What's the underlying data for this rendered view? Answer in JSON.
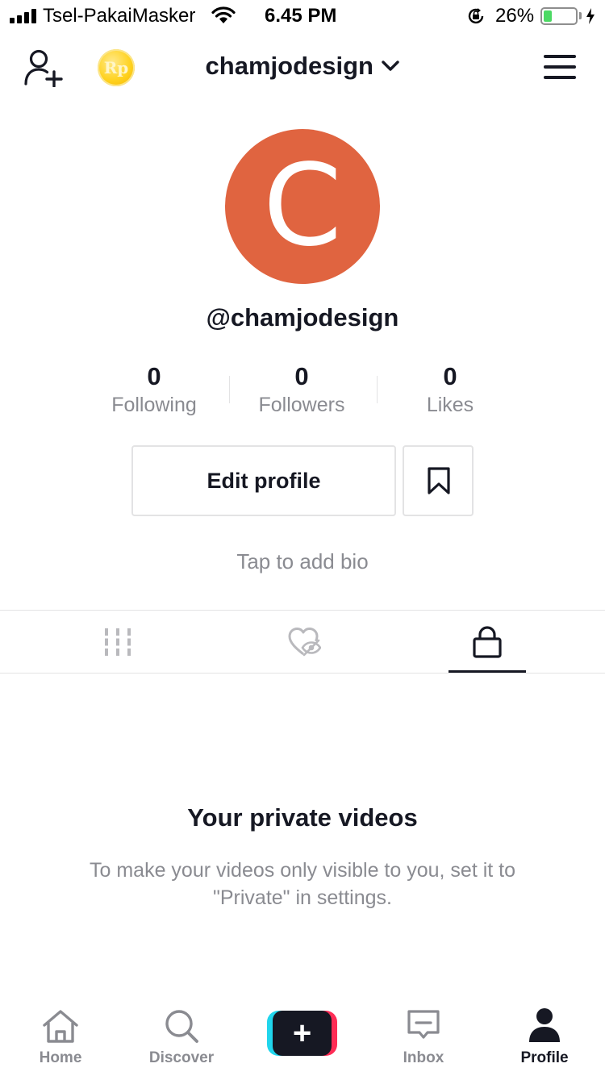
{
  "status_bar": {
    "carrier": "Tsel-PakaiMasker",
    "time": "6.45 PM",
    "battery_percent": "26%",
    "battery_level": 0.26,
    "signal_icon": "cellular-signal-icon",
    "wifi_icon": "wifi-icon",
    "rotation_icon": "rotation-lock-icon",
    "charging_icon": "charging-bolt-icon"
  },
  "header": {
    "username": "chamjodesign",
    "coin_label": "Rp",
    "add_user_icon": "add-user-icon",
    "dropdown_icon": "chevron-down-icon",
    "menu_icon": "hamburger-menu-icon"
  },
  "profile": {
    "avatar_letter": "C",
    "avatar_color": "#e06440",
    "handle": "@chamjodesign",
    "stats": [
      {
        "value": "0",
        "label": "Following"
      },
      {
        "value": "0",
        "label": "Followers"
      },
      {
        "value": "0",
        "label": "Likes"
      }
    ],
    "edit_button": "Edit profile",
    "bookmark_icon": "bookmark-icon",
    "bio_placeholder": "Tap to add bio"
  },
  "tabs": [
    {
      "icon": "grid-icon",
      "active": false
    },
    {
      "icon": "liked-hidden-icon",
      "active": false
    },
    {
      "icon": "lock-icon",
      "active": true
    }
  ],
  "empty_state": {
    "title": "Your private videos",
    "description": "To make your videos only visible to you, set it to \"Private\" in settings."
  },
  "bottom_nav": {
    "items": [
      {
        "label": "Home",
        "icon": "home-icon",
        "active": false
      },
      {
        "label": "Discover",
        "icon": "search-icon",
        "active": false
      },
      {
        "label": "",
        "icon": "plus-icon",
        "active": false
      },
      {
        "label": "Inbox",
        "icon": "inbox-icon",
        "active": false
      },
      {
        "label": "Profile",
        "icon": "profile-icon",
        "active": true
      }
    ],
    "create_symbol": "+"
  },
  "colors": {
    "primary_text": "#161823",
    "secondary_text": "#8a8b91",
    "divider": "#e3e3e4",
    "accent_cyan": "#20d5ec",
    "accent_red": "#fe2c55",
    "battery_green": "#4cd964"
  }
}
